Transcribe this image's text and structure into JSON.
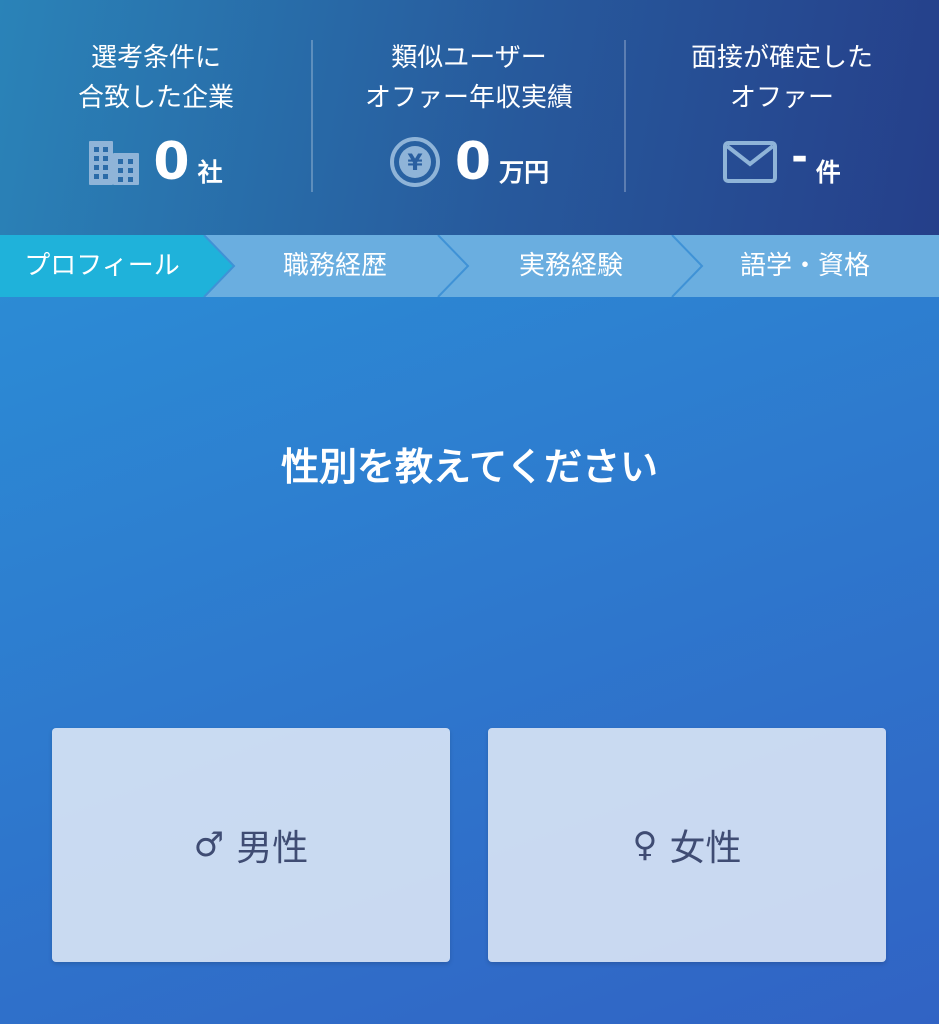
{
  "stats": [
    {
      "label_line1": "選考条件に",
      "label_line2": "合致した企業",
      "value": "0",
      "unit": "社",
      "icon": "building-icon"
    },
    {
      "label_line1": "類似ユーザー",
      "label_line2": "オファー年収実績",
      "value": "0",
      "unit": "万円",
      "icon": "yen-coin-icon"
    },
    {
      "label_line1": "面接が確定した",
      "label_line2": "オファー",
      "value": "-",
      "unit": "件",
      "icon": "mail-icon"
    }
  ],
  "steps": [
    {
      "label": "プロフィール",
      "active": true
    },
    {
      "label": "職務経歴",
      "active": false
    },
    {
      "label": "実務経験",
      "active": false
    },
    {
      "label": "語学・資格",
      "active": false
    }
  ],
  "question": "性別を教えてください",
  "choices": {
    "male": {
      "symbol": "♂",
      "label": "男性"
    },
    "female": {
      "symbol": "♀",
      "label": "女性"
    }
  },
  "colors": {
    "active_step": "#1fb2da",
    "inactive_step": "#6aaee0",
    "choice_text": "#3f4c73"
  }
}
